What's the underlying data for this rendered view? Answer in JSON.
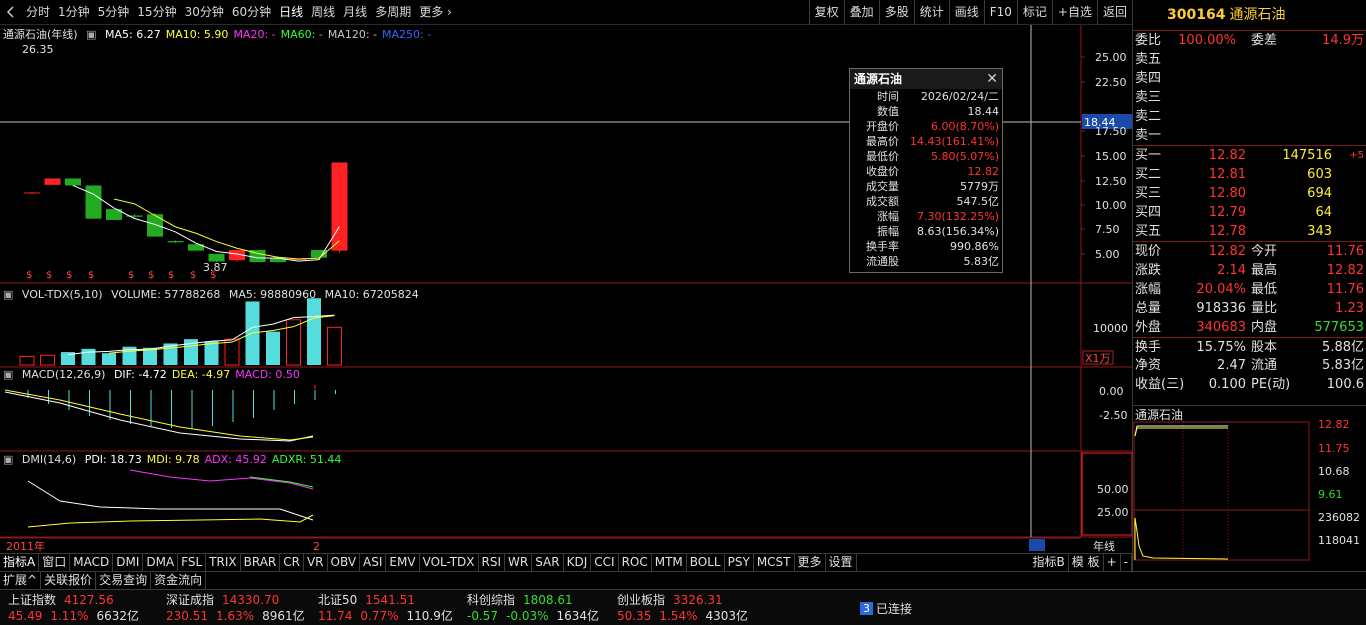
{
  "toolbar": {
    "periods": [
      "分时",
      "1分钟",
      "5分钟",
      "15分钟",
      "30分钟",
      "60分钟",
      "日线",
      "周线",
      "月线",
      "多周期"
    ],
    "more": "更多",
    "buttons": [
      "复权",
      "叠加",
      "多股",
      "统计",
      "画线",
      "F10",
      "标记",
      "+自选",
      "返回"
    ]
  },
  "main_pane": {
    "title": "通源石油(年线)",
    "ma": [
      {
        "label": "MA5: 6.27",
        "color": "#ffffff"
      },
      {
        "label": "MA10: 5.90",
        "color": "#ffff33"
      },
      {
        "label": "MA20: -",
        "color": "#ff33ff"
      },
      {
        "label": "MA60: -",
        "color": "#33ff33"
      },
      {
        "label": "MA120: -",
        "color": "#c8c8c8"
      },
      {
        "label": "MA250: -",
        "color": "#3366ff"
      }
    ],
    "high_label": "26.35",
    "low_label": "3.87",
    "crosshair_value": "18.44",
    "y_ticks": [
      "25.00",
      "22.50",
      "17.50",
      "15.00",
      "12.50",
      "10.00",
      "7.50",
      "5.00"
    ],
    "dividend_marks": [
      "$",
      "$",
      "$",
      "$",
      "$",
      "$",
      "$",
      "$",
      "$"
    ]
  },
  "vol_pane": {
    "title": "VOL-TDX(5,10)",
    "values": [
      "VOLUME: 57788268",
      "MA5: 98880960",
      "MA10: 67205824"
    ],
    "y_tick": "10000",
    "unit": "X1万"
  },
  "macd_pane": {
    "title": "MACD(12,26,9)",
    "values": [
      {
        "label": "DIF: -4.72",
        "color": "#ffffff"
      },
      {
        "label": "DEA: -4.97",
        "color": "#ffff33"
      },
      {
        "label": "MACD: 0.50",
        "color": "#ff33ff"
      }
    ],
    "y_ticks": [
      "0.00",
      "-2.50"
    ]
  },
  "dmi_pane": {
    "title": "DMI(14,6)",
    "values": [
      {
        "label": "PDI: 18.73",
        "color": "#ffffff"
      },
      {
        "label": "MDI: 9.78",
        "color": "#ffff33"
      },
      {
        "label": "ADX: 45.92",
        "color": "#ff33ff"
      },
      {
        "label": "ADXR: 51.44",
        "color": "#33ff33"
      }
    ],
    "y_ticks": [
      "50.00",
      "25.00"
    ]
  },
  "x_axis": {
    "start": "2011年",
    "cursor": "2",
    "right_label": "年线"
  },
  "popup": {
    "title": "通源石油",
    "rows": [
      {
        "k": "时间",
        "v": "2026/02/24/二",
        "red": false
      },
      {
        "k": "数值",
        "v": "18.44",
        "red": false
      },
      {
        "k": "开盘价",
        "v": "6.00(8.70%)",
        "red": true
      },
      {
        "k": "最高价",
        "v": "14.43(161.41%)",
        "red": true
      },
      {
        "k": "最低价",
        "v": "5.80(5.07%)",
        "red": true
      },
      {
        "k": "收盘价",
        "v": "12.82",
        "red": true
      },
      {
        "k": "成交量",
        "v": "5779万",
        "red": false
      },
      {
        "k": "成交额",
        "v": "547.5亿",
        "red": false
      },
      {
        "k": "涨幅",
        "v": "7.30(132.25%)",
        "red": true
      },
      {
        "k": "振幅",
        "v": "8.63(156.34%)",
        "red": false
      },
      {
        "k": "换手率",
        "v": "990.86%",
        "red": false
      },
      {
        "k": "流通股",
        "v": "5.83亿",
        "red": false
      }
    ]
  },
  "quote": {
    "code": "300164",
    "name": "通源石油",
    "weibi_label": "委比",
    "weibi": "100.00%",
    "weicha_label": "委差",
    "weicha": "14.9万",
    "asks": [
      "卖五",
      "卖四",
      "卖三",
      "卖二",
      "卖一"
    ],
    "bids": [
      {
        "label": "买一",
        "price": "12.82",
        "vol": "147516",
        "chg": "+5"
      },
      {
        "label": "买二",
        "price": "12.81",
        "vol": "603",
        "chg": ""
      },
      {
        "label": "买三",
        "price": "12.80",
        "vol": "694",
        "chg": ""
      },
      {
        "label": "买四",
        "price": "12.79",
        "vol": "64",
        "chg": ""
      },
      {
        "label": "买五",
        "price": "12.78",
        "vol": "343",
        "chg": ""
      }
    ],
    "stats": [
      {
        "l1": "现价",
        "v1": "12.82",
        "c1": "red",
        "l2": "今开",
        "v2": "11.76",
        "c2": "red"
      },
      {
        "l1": "涨跌",
        "v1": "2.14",
        "c1": "red",
        "l2": "最高",
        "v2": "12.82",
        "c2": "red"
      },
      {
        "l1": "涨幅",
        "v1": "20.04%",
        "c1": "red",
        "l2": "最低",
        "v2": "11.76",
        "c2": "red"
      },
      {
        "l1": "总量",
        "v1": "918336",
        "c1": "wht",
        "l2": "量比",
        "v2": "1.23",
        "c2": "red"
      },
      {
        "l1": "外盘",
        "v1": "340683",
        "c1": "red",
        "l2": "内盘",
        "v2": "577653",
        "c2": "grn"
      },
      {
        "l1": "换手",
        "v1": "15.75%",
        "c1": "wht",
        "l2": "股本",
        "v2": "5.88亿",
        "c2": "wht"
      },
      {
        "l1": "净资",
        "v1": "2.47",
        "c1": "wht",
        "l2": "流通",
        "v2": "5.83亿",
        "c2": "wht"
      },
      {
        "l1": "收益(三)",
        "v1": "0.100",
        "c1": "wht",
        "l2": "PE(动)",
        "v2": "100.6",
        "c2": "wht"
      }
    ]
  },
  "mini": {
    "title": "通源石油",
    "ticks": [
      "12.82",
      "11.75",
      "10.68",
      "9.61",
      "236082",
      "118041"
    ]
  },
  "tabs": [
    "指标A",
    "窗口",
    "MACD",
    "DMI",
    "DMA",
    "FSL",
    "TRIX",
    "BRAR",
    "CR",
    "VR",
    "OBV",
    "ASI",
    "EMV",
    "VOL-TDX",
    "RSI",
    "WR",
    "SAR",
    "KDJ",
    "CCI",
    "ROC",
    "MTM",
    "BOLL",
    "PSY",
    "MCST",
    "更多",
    "设置"
  ],
  "tabs_right": [
    "指标B",
    "模 板",
    "+",
    "-"
  ],
  "tabs2": [
    "扩展^",
    "关联报价",
    "交易查询",
    "资金流向"
  ],
  "status": {
    "indices": [
      {
        "name": "上证指数",
        "value": "4127.56",
        "chg": "45.49",
        "pct": "1.11%",
        "amt": "6632亿",
        "dir": "red"
      },
      {
        "name": "深证成指",
        "value": "14330.70",
        "chg": "230.51",
        "pct": "1.63%",
        "amt": "8961亿",
        "dir": "red"
      },
      {
        "name": "北证50",
        "value": "1541.51",
        "chg": "11.74",
        "pct": "0.77%",
        "amt": "110.9亿",
        "dir": "red"
      },
      {
        "name": "科创综指",
        "value": "1808.61",
        "chg": "-0.57",
        "pct": "-0.03%",
        "amt": "1634亿",
        "dir": "grn"
      },
      {
        "name": "创业板指",
        "value": "3326.31",
        "chg": "50.35",
        "pct": "1.54%",
        "amt": "4303亿",
        "dir": "red"
      }
    ],
    "conn_badge": "3",
    "conn_text": "已连接"
  },
  "chart_data": {
    "type": "candlestick",
    "title": "通源石油(年线)",
    "candles": [
      {
        "o": 4.5,
        "c": 4.6,
        "h": 4.7,
        "l": 4.4
      },
      {
        "o": 5.8,
        "c": 6.8,
        "h": 6.8,
        "l": 5.8
      },
      {
        "o": 6.8,
        "c": 5.7,
        "h": 6.8,
        "l": 5.6
      },
      {
        "o": 5.7,
        "c": 0.5,
        "h": 5.7,
        "l": 0.5
      },
      {
        "o": 2.0,
        "c": 0.3,
        "h": 2.0,
        "l": 0.3
      },
      {
        "o": 1.0,
        "c": 0.8,
        "h": 1.2,
        "l": 0.7
      },
      {
        "o": 1.2,
        "c": -2.3,
        "h": 1.4,
        "l": -2.3
      },
      {
        "o": -3.0,
        "c": -3.2,
        "h": -2.9,
        "l": -3.3
      },
      {
        "o": -3.5,
        "c": -4.5,
        "h": -3.4,
        "l": -4.5
      },
      {
        "o": -5.0,
        "c": -6.2,
        "h": -5.0,
        "l": -6.3
      },
      {
        "o": -6.0,
        "c": -4.4,
        "h": -4.4,
        "l": -6.2
      },
      {
        "o": -4.4,
        "c": -6.3,
        "h": -4.4,
        "l": -6.3
      },
      {
        "o": -5.6,
        "c": -6.3,
        "h": -5.4,
        "l": -6.4
      },
      {
        "o": -5.8,
        "c": -5.8,
        "h": -5.7,
        "l": -5.9
      },
      {
        "o": -4.4,
        "c": -5.6,
        "h": -4.4,
        "l": -5.7
      },
      {
        "o": -4.5,
        "c": 9.3,
        "h": 9.3,
        "l": -4.8
      }
    ],
    "volume": [
      0.8,
      0.9,
      1.2,
      1.5,
      1.1,
      1.7,
      1.6,
      2.0,
      2.4,
      2.2,
      2.4,
      5.9,
      3.1,
      4.2,
      6.2,
      3.5
    ],
    "ylim": [
      -8,
      28
    ]
  }
}
